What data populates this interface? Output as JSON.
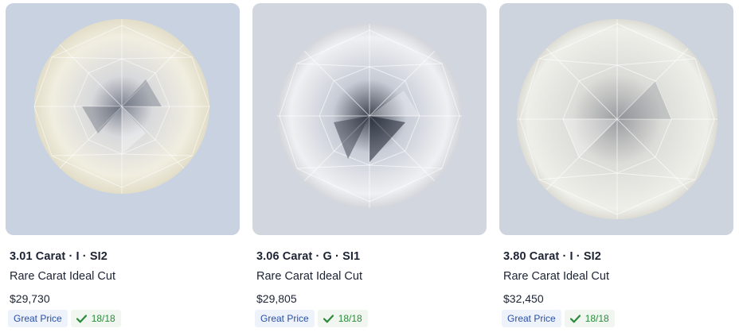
{
  "listings": [
    {
      "title": "3.01 Carat · I · SI2",
      "subtitle": "Rare Carat Ideal Cut",
      "price": "$29,730",
      "deal_badge": "Great Price",
      "score": "18/18",
      "image_icon": "round-diamond-image",
      "tint": "#f2efe2"
    },
    {
      "title": "3.06 Carat · G · SI1",
      "subtitle": "Rare Carat Ideal Cut",
      "price": "$29,805",
      "deal_badge": "Great Price",
      "score": "18/18",
      "image_icon": "round-diamond-image",
      "tint": "#eef0f3"
    },
    {
      "title": "3.80 Carat · I · SI2",
      "subtitle": "Rare Carat Ideal Cut",
      "price": "$32,450",
      "deal_badge": "Great Price",
      "score": "18/18",
      "image_icon": "round-diamond-image",
      "tint": "#f0f0ec"
    }
  ],
  "colors": {
    "card_background": "#c9d2e1",
    "badge_text": "#2a4fa8",
    "score_text": "#2a8a3a"
  }
}
